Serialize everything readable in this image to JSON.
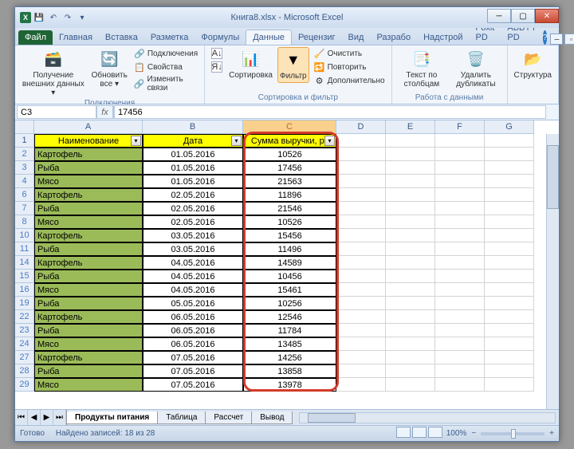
{
  "title": "Книга8.xlsx - Microsoft Excel",
  "qat": {
    "save": "💾",
    "undo": "↶",
    "redo": "↷"
  },
  "tabs": {
    "file": "Файл",
    "home": "Главная",
    "insert": "Вставка",
    "layout": "Разметка",
    "formulas": "Формулы",
    "data": "Данные",
    "review": "Рецензиг",
    "view": "Вид",
    "dev": "Разрабо",
    "addins": "Надстрой",
    "foxit": "Foxit PD",
    "abbyy": "ABBYY PD"
  },
  "ribbon": {
    "group1_label": "Подключения",
    "get_ext": "Получение\nвнешних данных ▾",
    "refresh": "Обновить\nвсе ▾",
    "connections": "Подключения",
    "properties": "Свойства",
    "editlinks": "Изменить связи",
    "group2_label": "Сортировка и фильтр",
    "sort_az": "А↓",
    "sort_za": "Я↓",
    "sort": "Сортировка",
    "filter": "Фильтр",
    "clear": "Очистить",
    "reapply": "Повторить",
    "advanced": "Дополнительно",
    "group3_label": "Работа с данными",
    "textcol": "Текст по\nстолбцам",
    "dedup": "Удалить\nдубликаты",
    "group4_label": "",
    "outline": "Структура"
  },
  "namebox": "C3",
  "formula": "17456",
  "cols": [
    "A",
    "B",
    "C",
    "D",
    "E",
    "F",
    "G"
  ],
  "headers": {
    "a": "Наименование",
    "b": "Дата",
    "c": "Сумма выручки, ру"
  },
  "rows": [
    {
      "n": 2,
      "a": "Картофель",
      "b": "01.05.2016",
      "c": "10526"
    },
    {
      "n": 3,
      "a": "Рыба",
      "b": "01.05.2016",
      "c": "17456"
    },
    {
      "n": 4,
      "a": "Мясо",
      "b": "01.05.2016",
      "c": "21563"
    },
    {
      "n": 6,
      "a": "Картофель",
      "b": "02.05.2016",
      "c": "11896"
    },
    {
      "n": 7,
      "a": "Рыба",
      "b": "02.05.2016",
      "c": "21546"
    },
    {
      "n": 8,
      "a": "Мясо",
      "b": "02.05.2016",
      "c": "10526"
    },
    {
      "n": 10,
      "a": "Картофель",
      "b": "03.05.2016",
      "c": "15456"
    },
    {
      "n": 11,
      "a": "Рыба",
      "b": "03.05.2016",
      "c": "11496"
    },
    {
      "n": 14,
      "a": "Картофель",
      "b": "04.05.2016",
      "c": "14589"
    },
    {
      "n": 15,
      "a": "Рыба",
      "b": "04.05.2016",
      "c": "10456"
    },
    {
      "n": 16,
      "a": "Мясо",
      "b": "04.05.2016",
      "c": "15461"
    },
    {
      "n": 19,
      "a": "Рыба",
      "b": "05.05.2016",
      "c": "10256"
    },
    {
      "n": 22,
      "a": "Картофель",
      "b": "06.05.2016",
      "c": "12546"
    },
    {
      "n": 23,
      "a": "Рыба",
      "b": "06.05.2016",
      "c": "11784"
    },
    {
      "n": 24,
      "a": "Мясо",
      "b": "06.05.2016",
      "c": "13485"
    },
    {
      "n": 27,
      "a": "Картофель",
      "b": "07.05.2016",
      "c": "14256"
    },
    {
      "n": 28,
      "a": "Рыба",
      "b": "07.05.2016",
      "c": "13858"
    },
    {
      "n": 29,
      "a": "Мясо",
      "b": "07.05.2016",
      "c": "13978"
    }
  ],
  "sheets": {
    "s1": "Продукты питания",
    "s2": "Таблица",
    "s3": "Рассчет",
    "s4": "Вывод"
  },
  "status": {
    "ready": "Готово",
    "records": "Найдено записей: 18 из 28",
    "zoom": "100%"
  }
}
